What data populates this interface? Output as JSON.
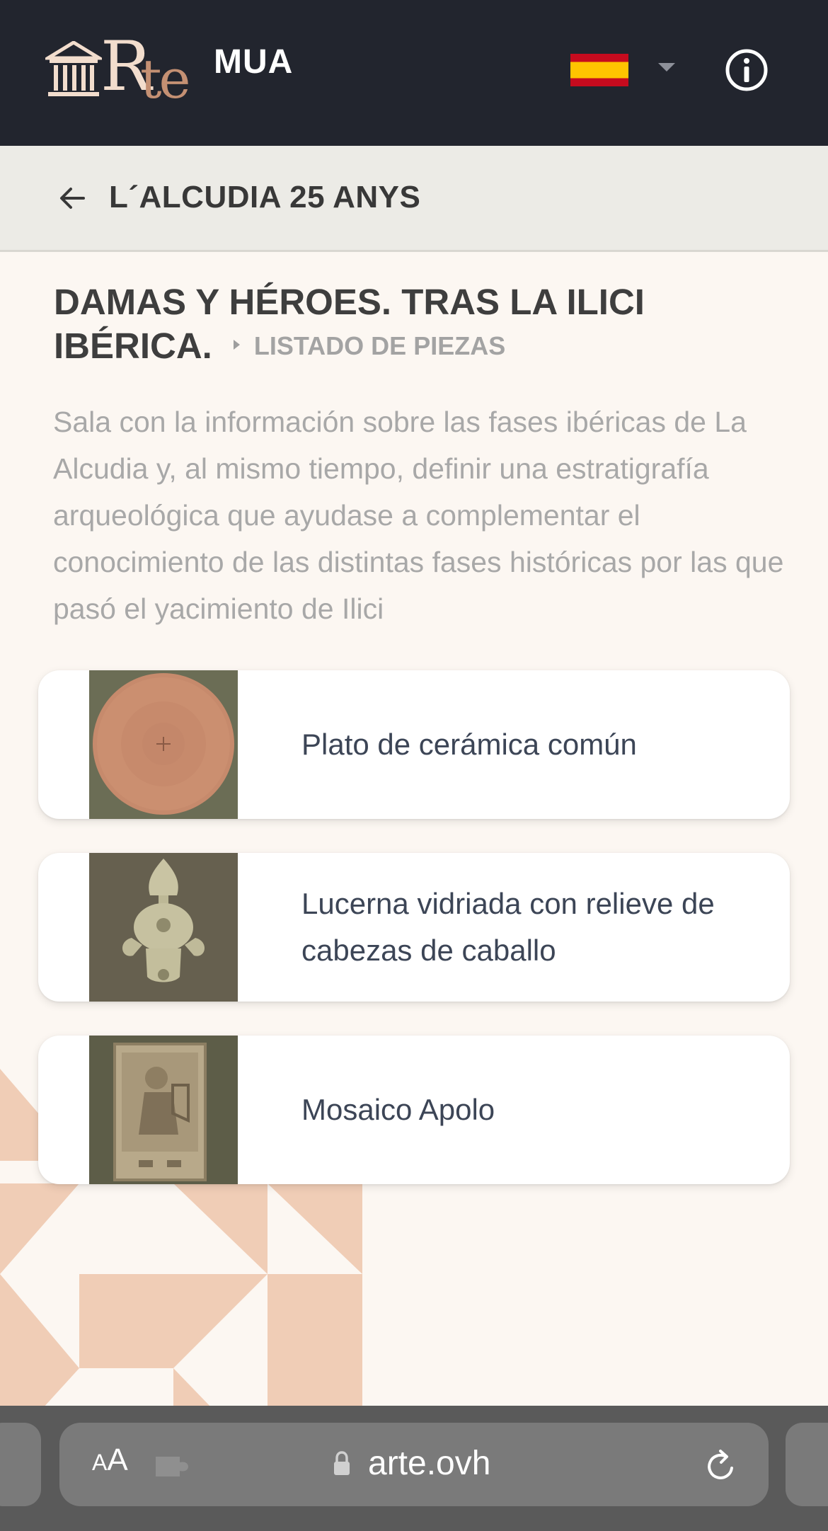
{
  "header": {
    "logo_mark": "Rte",
    "logo_r": "R",
    "logo_te": "te",
    "brand_suffix": "MUA",
    "language_icon": "spain-flag-icon",
    "language_caret_icon": "caret-down-icon",
    "info_icon": "info-icon"
  },
  "subheader": {
    "back_icon": "arrow-left-icon",
    "title": "L´ALCUDIA 25 ANYS"
  },
  "section": {
    "title": "DAMAS Y HÉROES. TRAS LA ILICI IBÉRICA.",
    "crumb": "LISTADO DE PIEZAS",
    "description": "Sala con la información sobre las fases ibéricas de La Alcudia y, al mismo tiempo, definir una estratigrafía arqueológica que ayudase a complementar el conocimiento de las distintas fases históricas por las que pasó el yacimiento de Ilici"
  },
  "pieces": [
    {
      "label": "Plato de cerámica común",
      "thumb_icon": "ceramic-plate-image"
    },
    {
      "label": "Lucerna vidriada con relieve de cabezas de caballo",
      "thumb_icon": "oil-lamp-image"
    },
    {
      "label": "Mosaico Apolo",
      "thumb_icon": "mosaic-image"
    }
  ],
  "browser": {
    "text_size_button": {
      "small": "A",
      "large": "A"
    },
    "url": "arte.ovh",
    "lock_icon": "lock-icon",
    "extension_icon": "puzzle-icon",
    "reload_icon": "reload-icon"
  },
  "colors": {
    "header_bg": "#22252e",
    "subheader_bg": "#ecebe6",
    "page_bg": "#fcf7f2",
    "pattern": "#f0cdb6",
    "logo_light": "#f2ddcd",
    "logo_accent": "#c49073"
  }
}
